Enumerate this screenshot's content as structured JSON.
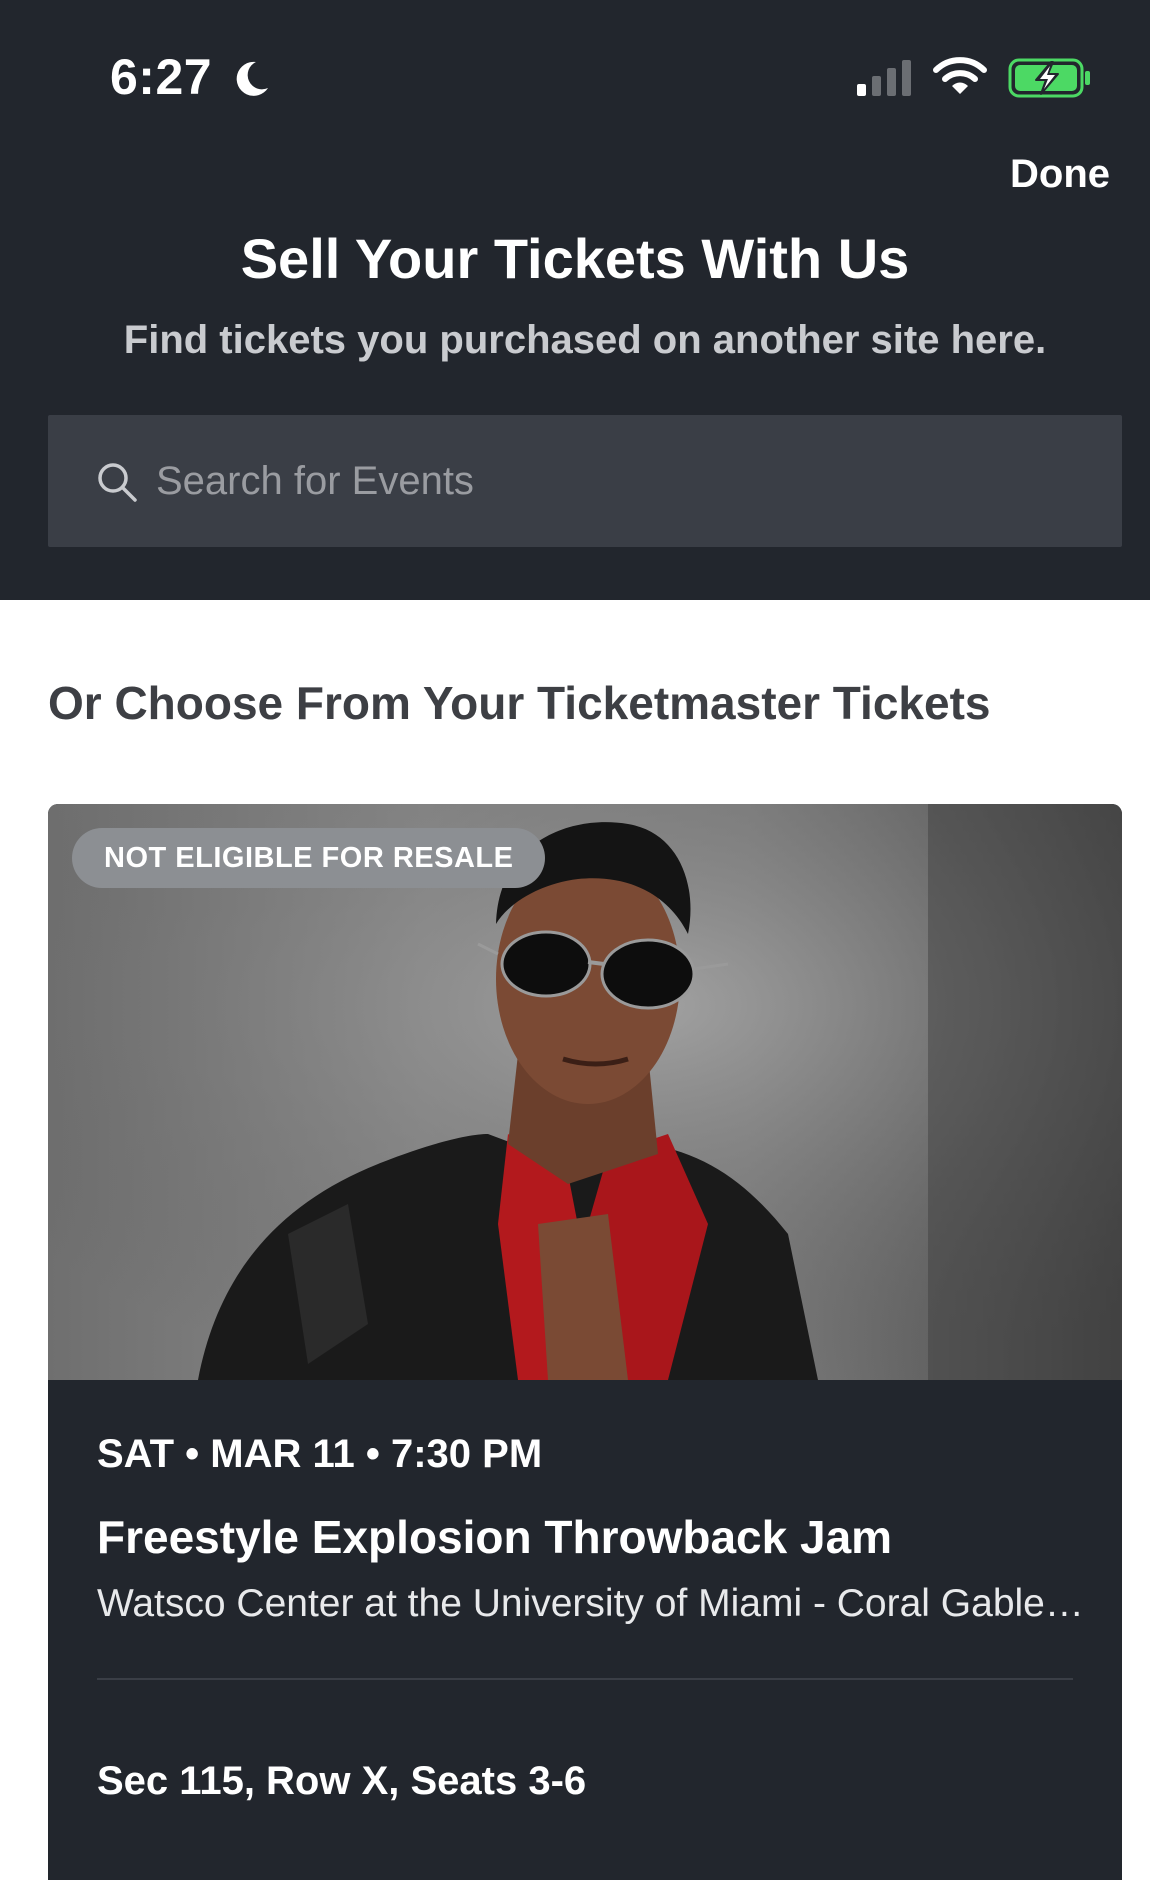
{
  "status_bar": {
    "time": "6:27",
    "icons": [
      "moon-icon",
      "cellular-signal-icon",
      "wifi-icon",
      "battery-charging-icon"
    ]
  },
  "header": {
    "done_label": "Done",
    "title": "Sell Your Tickets With Us",
    "subtitle": "Find tickets you purchased on another site here."
  },
  "search": {
    "placeholder": "Search for Events",
    "value": "",
    "icon": "search-icon"
  },
  "section": {
    "title": "Or Choose From Your Ticketmaster Tickets"
  },
  "event": {
    "badge": "NOT ELIGIBLE FOR RESALE",
    "date": "SAT • MAR 11 • 7:30 PM",
    "name": "Freestyle Explosion Throwback Jam",
    "venue": "Watsco Center at the University of Miami - Coral Gables, FL",
    "seats": "Sec 115, Row X, Seats 3-6"
  },
  "colors": {
    "header_bg": "#22262d",
    "search_bg": "#3a3e46",
    "card_bg": "#22262d",
    "badge_bg": "#8c8f93",
    "battery_green": "#4cd964"
  }
}
